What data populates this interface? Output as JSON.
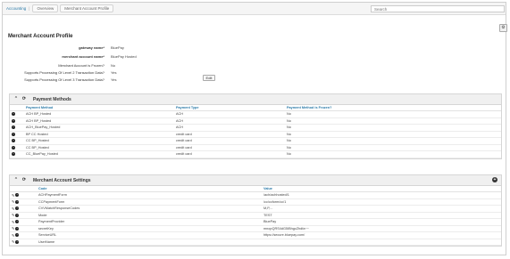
{
  "breadcrumb": [
    "Accounting",
    "Overview",
    "Merchant Account Profile"
  ],
  "search": {
    "placeholder": "Search"
  },
  "page_title": "Merchant Account Profile",
  "fields": [
    {
      "label": "gateway name*",
      "value": "BluePay",
      "bold": true
    },
    {
      "label": "merchant account name*",
      "value": "BluePay Hosted",
      "bold": true
    },
    {
      "label": "Merchant Account is Frozen?",
      "value": "No",
      "bold": false
    },
    {
      "label": "Supports Processing Of Level 2 Transaction Data?",
      "value": "Yes",
      "bold": false
    },
    {
      "label": "Supports Processing Of Level 3 Transaction Data?",
      "value": "Yes",
      "bold": false
    }
  ],
  "edit_label": "Edit",
  "payment_methods": {
    "title": "Payment Methods",
    "columns": [
      "Payment Method",
      "Payment Type",
      "Payment Method is Frozen?"
    ],
    "rows": [
      [
        "ACH BP_Hosted",
        "ACH",
        "No"
      ],
      [
        "ACH BP_Hosted",
        "ACH",
        "No"
      ],
      [
        "ACH_BluePay_Hosted",
        "ACH",
        "No"
      ],
      [
        "BP CC Hosted",
        "credit card",
        "No"
      ],
      [
        "CC BP_Hosted",
        "credit card",
        "No"
      ],
      [
        "CC BP_Hosted",
        "credit card",
        "No"
      ],
      [
        "CC_BluePay_Hosted",
        "credit card",
        "No"
      ]
    ]
  },
  "settings": {
    "title": "Merchant Account Settings",
    "columns": [
      "Code",
      "Value"
    ],
    "rows": [
      [
        "ACHPaymentForm",
        "/ach/achhosted/1"
      ],
      [
        "CCPaymentForm",
        "/cc/ccform/cc/1"
      ],
      [
        "CVVMatchResponseCodes",
        "M,P,..."
      ],
      [
        "Mode",
        "TEST"
      ],
      [
        "PaymentProvider",
        "BluePay"
      ],
      [
        "secretKey",
        "mnopQRS4dG5IBhgcZhdfa~~"
      ],
      [
        "ServiceURL",
        "https://secure.bluepay.com/"
      ],
      [
        "UserName",
        ""
      ]
    ]
  }
}
